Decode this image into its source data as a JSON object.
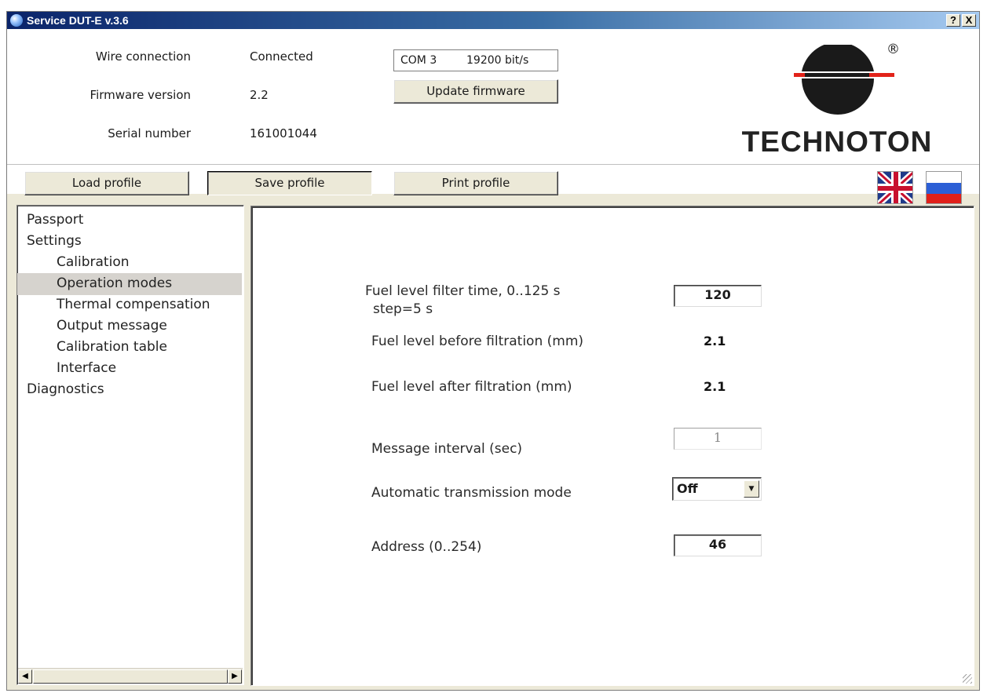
{
  "window": {
    "title": "Service DUT-E  v.3.6",
    "help_label": "?",
    "close_label": "X"
  },
  "status": {
    "wire_label": "Wire connection",
    "wire_value": "Connected",
    "fw_label": "Firmware version",
    "fw_value": "2.2",
    "sn_label": "Serial number",
    "sn_value": "161001044"
  },
  "port": {
    "com": "COM 3",
    "speed": "19200 bit/s"
  },
  "buttons": {
    "update": "Update firmware",
    "load": "Load profile",
    "save": "Save profile",
    "print": "Print profile"
  },
  "logo": {
    "brand": "TECHNOTON",
    "reg": "®"
  },
  "languages": [
    "english-flag",
    "russian-flag"
  ],
  "tree": [
    {
      "label": "Passport",
      "level": 0
    },
    {
      "label": "Settings",
      "level": 0
    },
    {
      "label": "Calibration",
      "level": 1
    },
    {
      "label": "Operation modes",
      "level": 1,
      "selected": true
    },
    {
      "label": "Thermal compensation",
      "level": 1
    },
    {
      "label": "Output message",
      "level": 1
    },
    {
      "label": "Calibration table",
      "level": 1
    },
    {
      "label": "Interface",
      "level": 1
    },
    {
      "label": "Diagnostics",
      "level": 0
    }
  ],
  "operation_modes": {
    "filter_time_label_1": "Fuel level filter time, 0..125 s",
    "filter_time_label_2": "step=5 s",
    "filter_time_value": "120",
    "before_label": "Fuel level before filtration (mm)",
    "before_value": "2.1",
    "after_label": "Fuel level after filtration (mm)",
    "after_value": "2.1",
    "interval_label": "Message interval (sec)",
    "interval_value": "1",
    "auto_label": "Automatic transmission mode",
    "auto_value": "Off",
    "address_label": "Address (0..254)",
    "address_value": "46"
  },
  "colors": {
    "title_start": "#0a246a",
    "title_end": "#a6caf0",
    "logo_red": "#e2231a",
    "logo_black": "#1a1a1a"
  }
}
